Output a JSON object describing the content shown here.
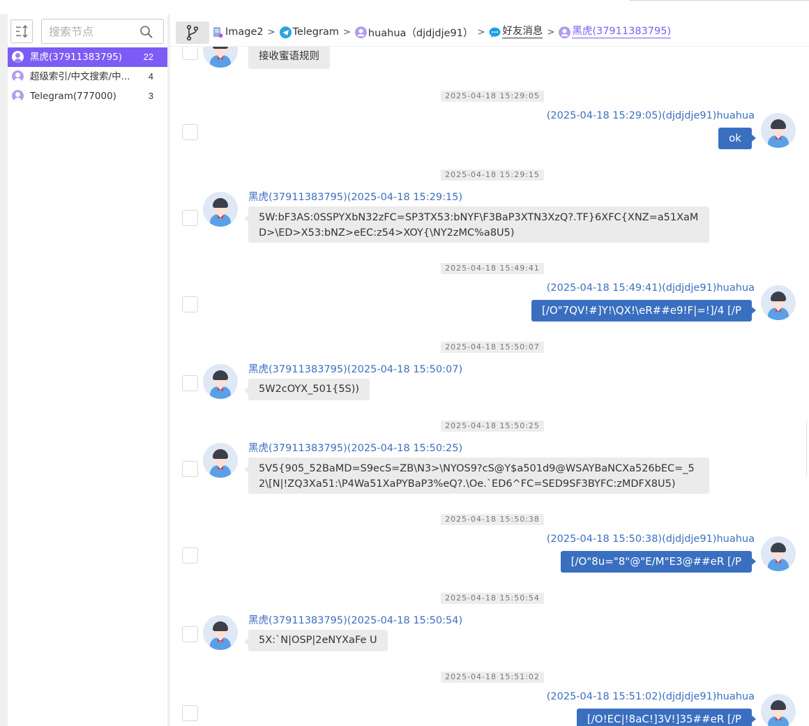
{
  "sidebar": {
    "search_placeholder": "搜索节点",
    "items": [
      {
        "label": "黑虎(37911383795)",
        "count": "22",
        "active": true
      },
      {
        "label": "超级索引/中文搜索/中...",
        "count": "4",
        "active": false
      },
      {
        "label": "Telegram(777000)",
        "count": "3",
        "active": false
      }
    ]
  },
  "breadcrumb": {
    "items": [
      {
        "label": "Image2",
        "icon": "image-file-icon"
      },
      {
        "label": "Telegram",
        "icon": "telegram-icon"
      },
      {
        "label": "huahua（djdjdje91）",
        "icon": "user-avatar-icon"
      },
      {
        "label": "好友消息",
        "icon": "chat-bubble-icon"
      },
      {
        "label": "黑虎(37911383795)",
        "icon": "user-avatar-icon"
      }
    ]
  },
  "chat": {
    "partial_top_message": "接收蜜语规则",
    "messages": [
      {
        "time": "2025-04-18 15:29:05",
        "direction": "out",
        "sender": "(2025-04-18 15:29:05)(djdjdje91)huahua",
        "text": "ok"
      },
      {
        "time": "2025-04-18 15:29:15",
        "direction": "in",
        "sender": "黑虎(37911383795)(2025-04-18 15:29:15)",
        "text": "5W:bF3AS:0SSPYXbN32zFC=SP3TX53:bNYF\\F3BaP3XTN3XzQ?.TF}6XFC{XNZ=a51XaMD>\\ED>X53:bNZ>eEC:z54>XOY{\\NY2zMC%a8U5)"
      },
      {
        "time": "2025-04-18 15:49:41",
        "direction": "out",
        "sender": "(2025-04-18 15:49:41)(djdjdje91)huahua",
        "text": "[/O\"7QV!#]Y!\\QX!\\eR##e9!F|=!]/4 [/P"
      },
      {
        "time": "2025-04-18 15:50:07",
        "direction": "in",
        "sender": "黑虎(37911383795)(2025-04-18 15:50:07)",
        "text": "5W2cOYX_501{5S))"
      },
      {
        "time": "2025-04-18 15:50:25",
        "direction": "in",
        "sender": "黑虎(37911383795)(2025-04-18 15:50:25)",
        "text": "5V5{905_52BaMD=S9ecS=ZB\\N3>\\NYOS9?cS@Y$a501d9@WSAYBaNCXa526bEC=_52\\[N|!ZQ3Xa51:\\P4Wa51XaPYBaP3%eQ?.\\Oe.`ED6^FC=SED9SF3BYFC:zMDFX8U5)"
      },
      {
        "time": "2025-04-18 15:50:38",
        "direction": "out",
        "sender": "(2025-04-18 15:50:38)(djdjdje91)huahua",
        "text": "[/O\"8u=\"8\"@\"E/M\"E3@##eR [/P"
      },
      {
        "time": "2025-04-18 15:50:54",
        "direction": "in",
        "sender": "黑虎(37911383795)(2025-04-18 15:50:54)",
        "text": "5X:`N|OSP|2eNYXaFe U"
      },
      {
        "time": "2025-04-18 15:51:02",
        "direction": "out",
        "sender": "(2025-04-18 15:51:02)(djdjdje91)huahua",
        "text": "[/O!EC|!8aC!]3V!]35##eR [/P"
      }
    ]
  },
  "colors": {
    "accent": "#7b5cf5",
    "outgoing_bubble": "#3a6fc0",
    "incoming_bubble": "#ebebeb",
    "sender_name": "#3c6fc0"
  }
}
